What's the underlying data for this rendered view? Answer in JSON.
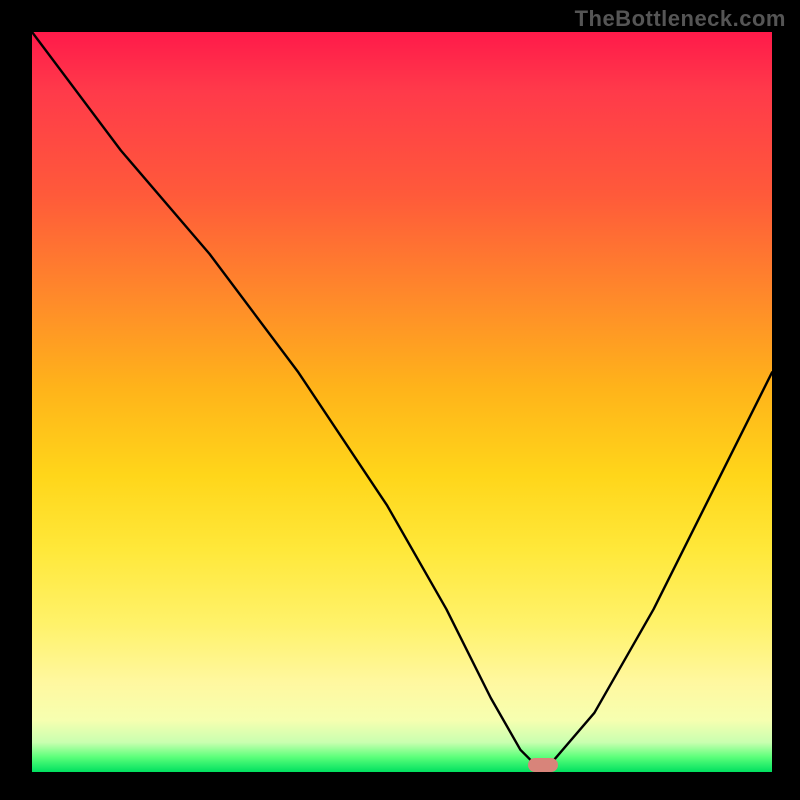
{
  "watermark": "TheBottleneck.com",
  "chart_data": {
    "type": "line",
    "title": "",
    "xlabel": "",
    "ylabel": "",
    "xlim": [
      0,
      100
    ],
    "ylim": [
      0,
      100
    ],
    "grid": false,
    "legend": false,
    "background_gradient": {
      "top": "#ff1a4a",
      "bottom": "#00e060"
    },
    "series": [
      {
        "name": "bottleneck-curve",
        "x": [
          0,
          12,
          24,
          36,
          48,
          56,
          62,
          66,
          68,
          70,
          76,
          84,
          92,
          100
        ],
        "values": [
          100,
          84,
          70,
          54,
          36,
          22,
          10,
          3,
          1,
          1,
          8,
          22,
          38,
          54
        ]
      }
    ],
    "marker": {
      "name": "optimal-point",
      "x": 69,
      "y": 1,
      "color": "#d8847a"
    }
  }
}
